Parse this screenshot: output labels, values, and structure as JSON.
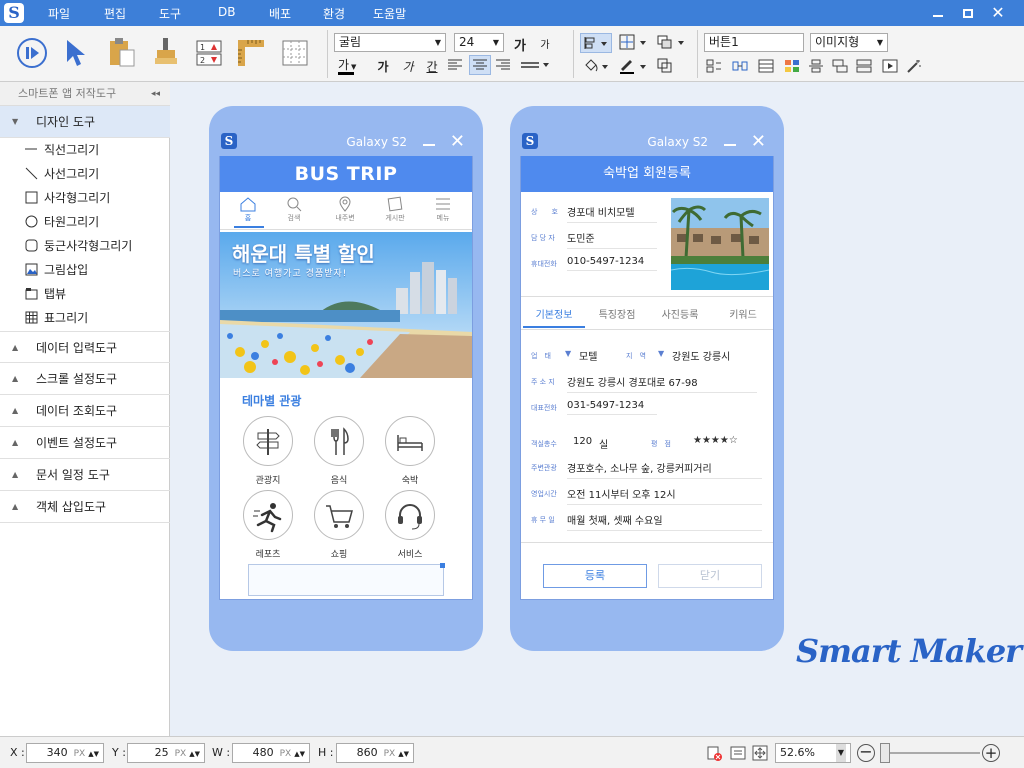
{
  "app": {
    "logo_letter": "S",
    "menus": [
      "파일",
      "편집",
      "도구",
      "DB",
      "배포",
      "환경",
      "도움말"
    ],
    "window_buttons": [
      "minimize",
      "restore",
      "close"
    ]
  },
  "toolbar": {
    "font_name": "굴림",
    "font_size": "24",
    "font_size_up": "가",
    "font_size_down": "가",
    "bold": "가",
    "italic": "가",
    "italic2": "가",
    "under": "간",
    "text_color_glyph": "가",
    "name_field": "버튼1",
    "type_field": "이미지형"
  },
  "sidebar": {
    "title": "스마트폰 앱 저작도구",
    "collapse": "◂◂",
    "section_design": "디자인 도구",
    "items": [
      "직선그리기",
      "사선그리기",
      "사각형그리기",
      "타원그리기",
      "둥근사각형그리기",
      "그림삽입",
      "탭뷰",
      "표그리기"
    ],
    "sections": [
      "데이터 입력도구",
      "스크롤 설정도구",
      "데이터 조회도구",
      "이벤트 설정도구",
      "문서 일정 도구",
      "객체 삽입도구"
    ]
  },
  "phone1": {
    "device": "Galaxy S2",
    "title": "BUS TRIP",
    "nav": [
      "홈",
      "검색",
      "내주변",
      "게시판",
      "메뉴"
    ],
    "banner_title": "해운대 특별 할인",
    "banner_sub": "버스로 여행가고 경품받자!",
    "section_title": "테마별 관광",
    "categories": [
      "관광지",
      "음식",
      "숙박",
      "레포츠",
      "쇼핑",
      "서비스"
    ]
  },
  "phone2": {
    "device": "Galaxy S2",
    "title": "숙박업 회원등록",
    "top_fields": [
      {
        "label": "상　　호",
        "value": "경포대 비치모텔"
      },
      {
        "label": "담 당 자",
        "value": "도민준"
      },
      {
        "label": "휴대전화",
        "value": "010-5497-1234"
      }
    ],
    "tabs": [
      "기본정보",
      "특징장점",
      "사진등록",
      "키워드"
    ],
    "type_label": "업　태",
    "type_value": "모텔",
    "region_label": "지　역",
    "region_value": "강원도 강릉시",
    "fields": [
      {
        "label": "주 소 지",
        "value": "강원도 강릉시 경포대로 67-98"
      },
      {
        "label": "대표전화",
        "value": "031-5497-1234"
      }
    ],
    "rooms_label": "객실총수",
    "rooms_value": "120",
    "rooms_unit": "실",
    "rating_label": "평　점",
    "rating_stars": "★★★★☆",
    "rating": 4,
    "fields2": [
      {
        "label": "주변관광",
        "value": "경포호수, 소나무 숲, 강릉커피거리"
      },
      {
        "label": "영업시간",
        "value": "오전 11시부터 오후 12시"
      },
      {
        "label": "휴 무 일",
        "value": "매월 첫째, 셋째 수요일"
      }
    ],
    "btn_register": "등록",
    "btn_close": "닫기"
  },
  "brand": "Smart Maker",
  "status": {
    "x_label": "X :",
    "x": "340",
    "y_label": "Y :",
    "y": "25",
    "w_label": "W :",
    "w": "480",
    "h_label": "H :",
    "h": "860",
    "unit": "PX",
    "zoom": "52.6%"
  }
}
